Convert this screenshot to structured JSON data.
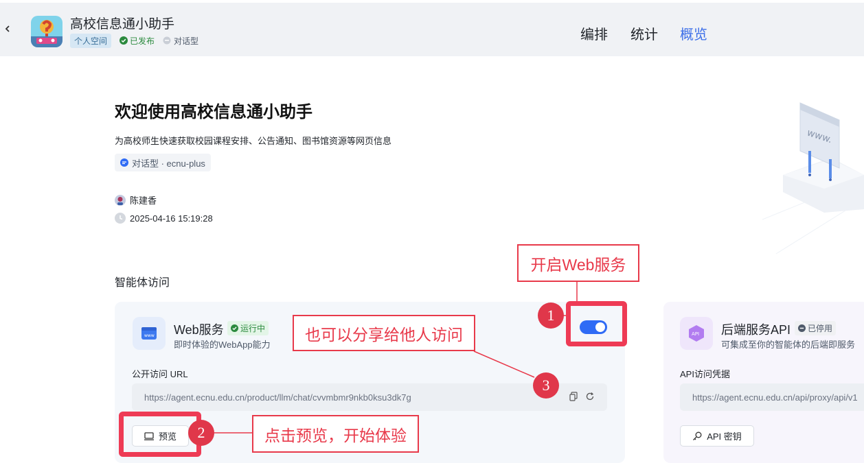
{
  "header": {
    "app_name": "高校信息通小助手",
    "space_tag": "个人空间",
    "status": "已发布",
    "app_type": "对话型",
    "nav": {
      "arrange": "编排",
      "stats": "统计",
      "overview": "概览"
    }
  },
  "overview": {
    "welcome": "欢迎使用高校信息通小助手",
    "description": "为高校师生快速获取校园课程安排、公告通知、图书馆资源等网页信息",
    "type_model": "对话型 · ecnu-plus",
    "author": "陈建香",
    "created_at": "2025-04-16 15:19:28"
  },
  "access": {
    "section_title": "智能体访问",
    "web": {
      "title": "Web服务",
      "badge": "运行中",
      "subtitle": "即时体验的WebApp能力",
      "url_label": "公开访问 URL",
      "url": "https://agent.ecnu.edu.cn/product/llm/chat/cvvmbmr9nkb0ksu3dk7g",
      "preview_label": "预览",
      "enabled": true
    },
    "api": {
      "title": "后端服务API",
      "badge": "已停用",
      "subtitle": "可集成至你的智能体的后端即服务",
      "url_label": "API访问凭据",
      "url": "https://agent.ecnu.edu.cn/api/proxy/api/v1",
      "key_label": "API 密钥"
    }
  },
  "annotations": {
    "enable_web": "开启Web服务",
    "share": "也可以分享给他人访问",
    "preview": "点击预览，开始体验",
    "n1": "1",
    "n2": "2",
    "n3": "3"
  },
  "illustration": {
    "label": "www."
  },
  "colors": {
    "accent": "#3b6ee8",
    "toggle": "#2f6bf5",
    "annotation": "#e8394a",
    "running": "#2b8a3e"
  }
}
